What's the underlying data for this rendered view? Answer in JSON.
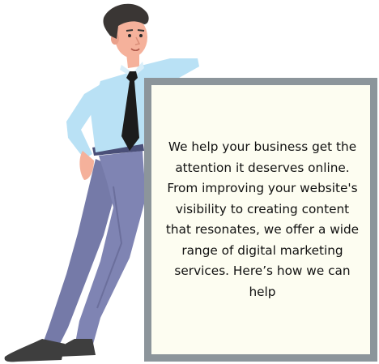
{
  "message": {
    "text": "We help your business get the attention it deserves online. From improving your website's visibility to creating content that resonates, we offer a wide range of digital marketing services. Here’s how we can help"
  },
  "colors": {
    "board_frame": "#8c959b",
    "board_fill": "#fdfdf1",
    "shirt": "#b9e1f5",
    "trousers": "#7f84b3",
    "tie": "#1c1c1c",
    "hair": "#3a3634",
    "skin": "#f5b19b",
    "shoes": "#3e3e3e",
    "text": "#111111"
  },
  "icons": [
    "businessman-illustration"
  ]
}
